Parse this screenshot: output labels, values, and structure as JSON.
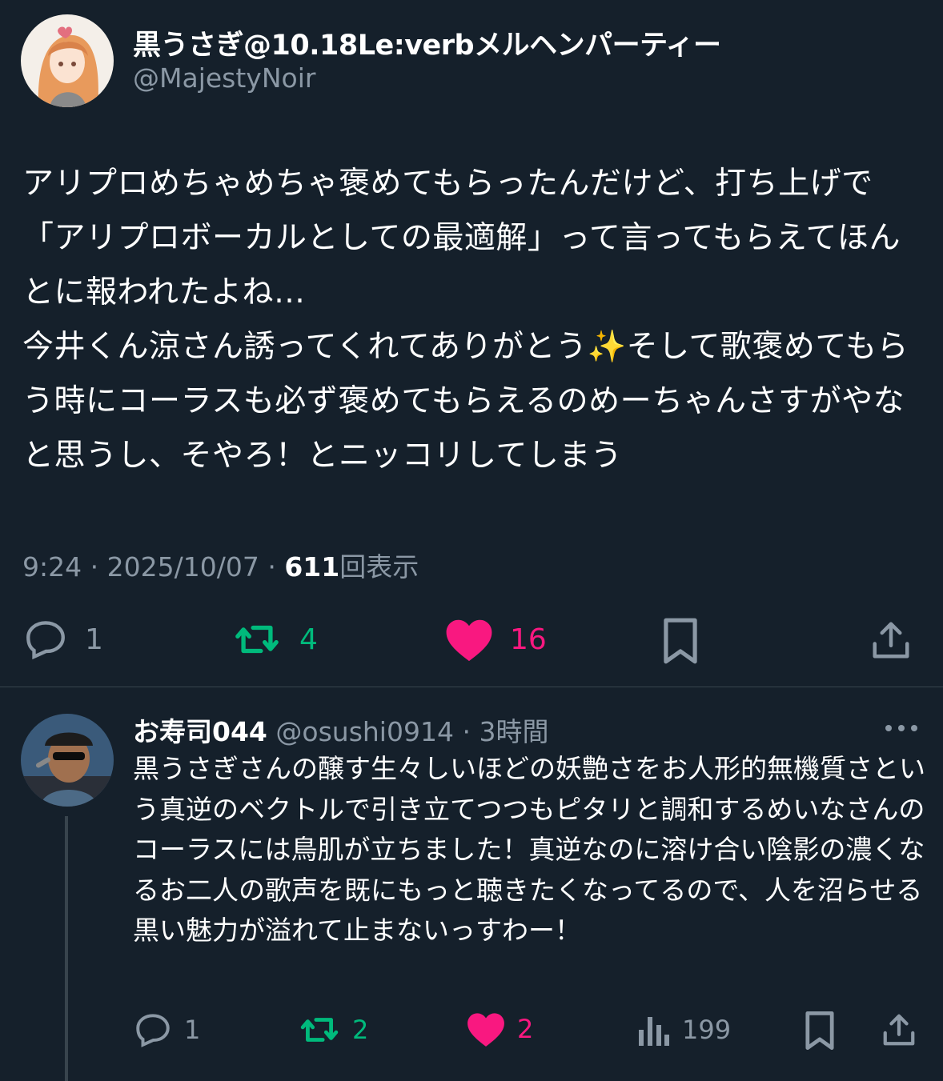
{
  "tweet": {
    "author_name": "黒うさぎ@10.18Le:verbメルヘンパーティー",
    "author_handle": "@MajestyNoir",
    "text": "アリプロめちゃめちゃ褒めてもらったんだけど、打ち上げで「アリプロボーカルとしての最適解」って言ってもらえてほんとに報われたよね…\n今井くん涼さん誘ってくれてありがとう✨そして歌褒めてもらう時にコーラスも必ず褒めてもらえるのめーちゃんさすがやなと思うし、そやろ！とニッコリしてしまう",
    "time": "9:24",
    "date": "2025/10/07",
    "separator": "·",
    "views": "611",
    "views_label": "回表示",
    "replies": "1",
    "retweets": "4",
    "likes": "16"
  },
  "reply": {
    "author_name": "お寿司044",
    "author_handle": "@osushi0914",
    "separator": "·",
    "time": "3時間",
    "text": "黒うさぎさんの醸す生々しいほどの妖艶さをお人形的無機質さという真逆のベクトルで引き立てつつもピタリと調和するめいなさんのコーラスには鳥肌が立ちました！真逆なのに溶け合い陰影の濃くなるお二人の歌声を既にもっと聴きたくなってるので、人を沼らせる黒い魅力が溢れて止まないっすわー！",
    "replies": "1",
    "retweets": "2",
    "likes": "2",
    "views": "199"
  },
  "colors": {
    "background": "#15202b",
    "secondary_text": "#8b98a5",
    "retweet": "#00ba7c",
    "like": "#f91880",
    "divider": "#38444d"
  },
  "icons": [
    "reply-icon",
    "retweet-icon",
    "heart-icon",
    "bookmark-icon",
    "share-icon",
    "views-icon",
    "more-icon"
  ]
}
